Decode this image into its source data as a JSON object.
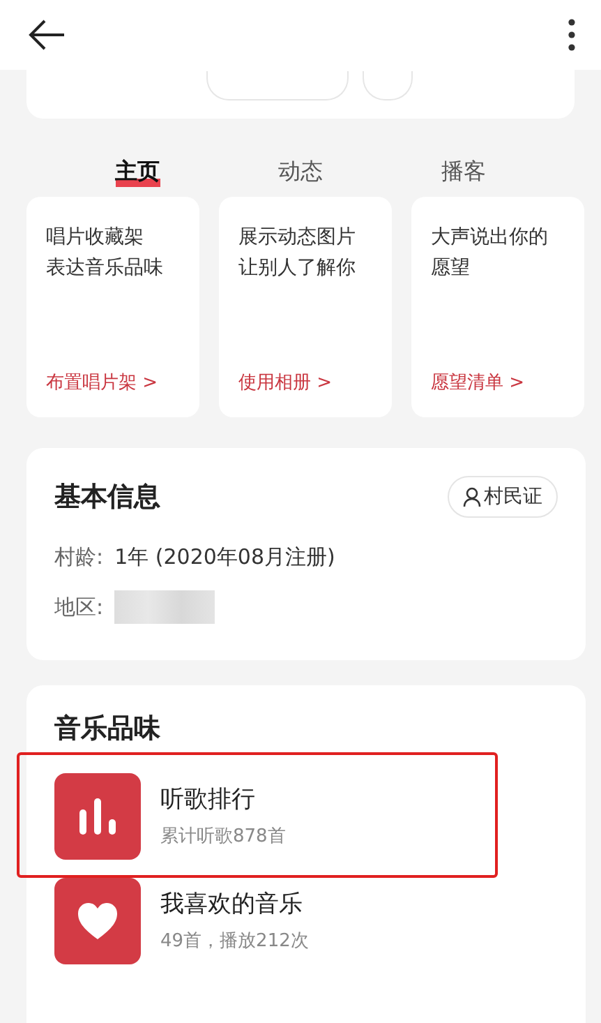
{
  "tabs": [
    {
      "label": "主页",
      "selected": true
    },
    {
      "label": "动态",
      "selected": false
    },
    {
      "label": "播客",
      "selected": false
    }
  ],
  "feature_cards": [
    {
      "lines": [
        "唱片收藏架",
        "表达音乐品味"
      ],
      "link": "布置唱片架 >"
    },
    {
      "lines": [
        "展示动态图片",
        "让别人了解你"
      ],
      "link": "使用相册 >"
    },
    {
      "lines": [
        "大声说出你的",
        "愿望"
      ],
      "link": "愿望清单 >"
    }
  ],
  "basic_info": {
    "title": "基本信息",
    "badge": "村民证",
    "rows": [
      {
        "label": "村龄:",
        "value": "1年 (2020年08月注册)",
        "blurred": false
      },
      {
        "label": "地区:",
        "blurred": true
      }
    ]
  },
  "music_taste": {
    "title": "音乐品味",
    "items": [
      {
        "kind": "ranking",
        "title": "听歌排行",
        "subtitle": "累计听歌878首",
        "highlighted": true
      },
      {
        "kind": "liked",
        "title": "我喜欢的音乐",
        "subtitle": "49首，播放212次",
        "highlighted": false
      }
    ]
  }
}
